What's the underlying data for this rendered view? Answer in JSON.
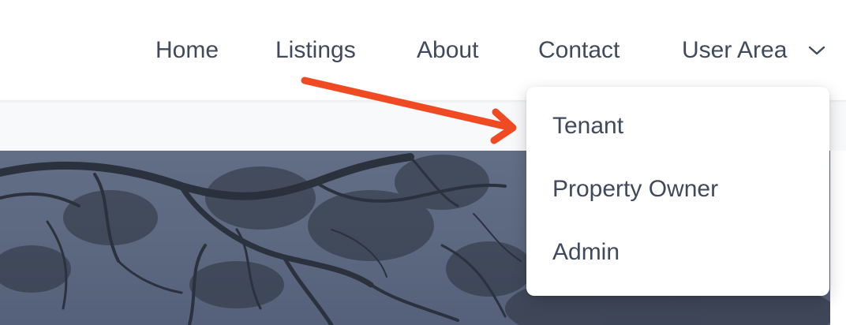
{
  "nav": {
    "items": [
      {
        "label": "Home"
      },
      {
        "label": "Listings"
      },
      {
        "label": "About"
      },
      {
        "label": "Contact"
      },
      {
        "label": "User Area",
        "icon": "chevron-down-icon"
      }
    ]
  },
  "dropdown": {
    "items": [
      {
        "label": "Tenant"
      },
      {
        "label": "Property Owner"
      },
      {
        "label": "Admin"
      }
    ]
  },
  "annotation": {
    "arrow_color": "#f04a23",
    "points_to": "Tenant"
  },
  "colors": {
    "nav_text": "#3f4a5c",
    "hero_sky": "#5d6981",
    "page_bg": "#f8f9fb"
  }
}
